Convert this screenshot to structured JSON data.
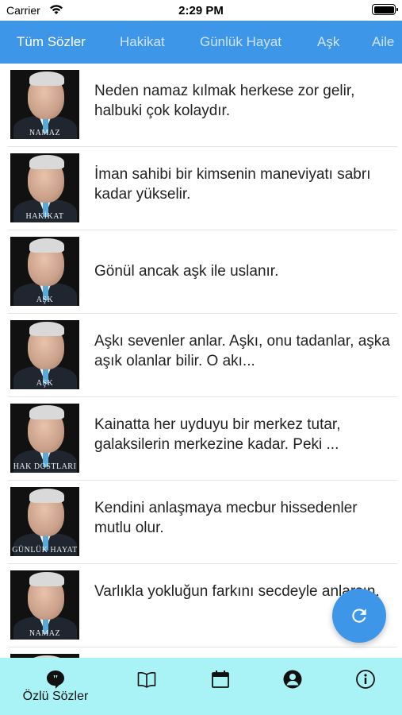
{
  "status": {
    "carrier": "Carrier",
    "time": "2:29 PM"
  },
  "tabs": [
    "Tüm Sözler",
    "Hakikat",
    "Günlük Hayat",
    "Aşk",
    "Aile"
  ],
  "items": [
    {
      "caption": "NAMAZ",
      "text": "Neden namaz kılmak herkese zor gelir, halbuki çok kolaydır."
    },
    {
      "caption": "HAKİKAT",
      "text": "İman sahibi bir kimsenin maneviyatı sabrı kadar yükselir."
    },
    {
      "caption": "AŞK",
      "text": "Gönül ancak aşk ile uslanır."
    },
    {
      "caption": "AŞK",
      "text": "Aşkı sevenler anlar. Aşkı, onu tadanlar, aşka aşık olanlar bilir. O akı..."
    },
    {
      "caption": "HAK DOSTLARI",
      "text": "Kainatta her uyduyu bir merkez tutar, galaksilerin merkezine kadar. Peki ..."
    },
    {
      "caption": "GÜNLÜK HAYAT",
      "text": "Kendini anlaşmaya mecbur hissedenler mutlu olur."
    },
    {
      "caption": "NAMAZ",
      "text": "Varlıkla yokluğun farkını secdeyle anlarsın."
    }
  ],
  "tabbar": {
    "active_label": "Özlü Sözler"
  },
  "icons": {
    "fab": "refresh-icon",
    "tabbar": [
      "quote-bubble-icon",
      "book-icon",
      "calendar-icon",
      "person-icon",
      "info-icon"
    ]
  },
  "colors": {
    "accent": "#3d96e8",
    "tabbar_bg": "#a9f3f6"
  }
}
